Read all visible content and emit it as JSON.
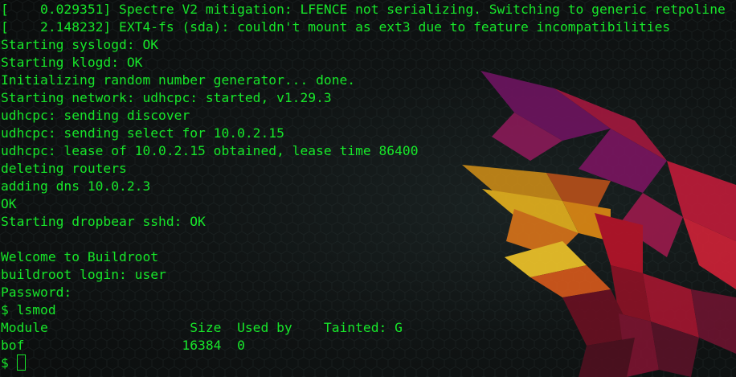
{
  "terminal": {
    "lines": [
      "[    0.029351] Spectre V2 mitigation: LFENCE not serializing. Switching to generic retpoline",
      "[    2.148232] EXT4-fs (sda): couldn't mount as ext3 due to feature incompatibilities",
      "Starting syslogd: OK",
      "Starting klogd: OK",
      "Initializing random number generator... done.",
      "Starting network: udhcpc: started, v1.29.3",
      "udhcpc: sending discover",
      "udhcpc: sending select for 10.0.2.15",
      "udhcpc: lease of 10.0.2.15 obtained, lease time 86400",
      "deleting routers",
      "adding dns 10.0.2.3",
      "OK",
      "Starting dropbear sshd: OK",
      "",
      "Welcome to Buildroot",
      "buildroot login: user",
      "Password:",
      "$ lsmod",
      "Module                  Size  Used by    Tainted: G",
      "bof                    16384  0"
    ],
    "prompt": "$ "
  },
  "colors": {
    "text": "#17e62a",
    "background": "#0b0c0d"
  }
}
